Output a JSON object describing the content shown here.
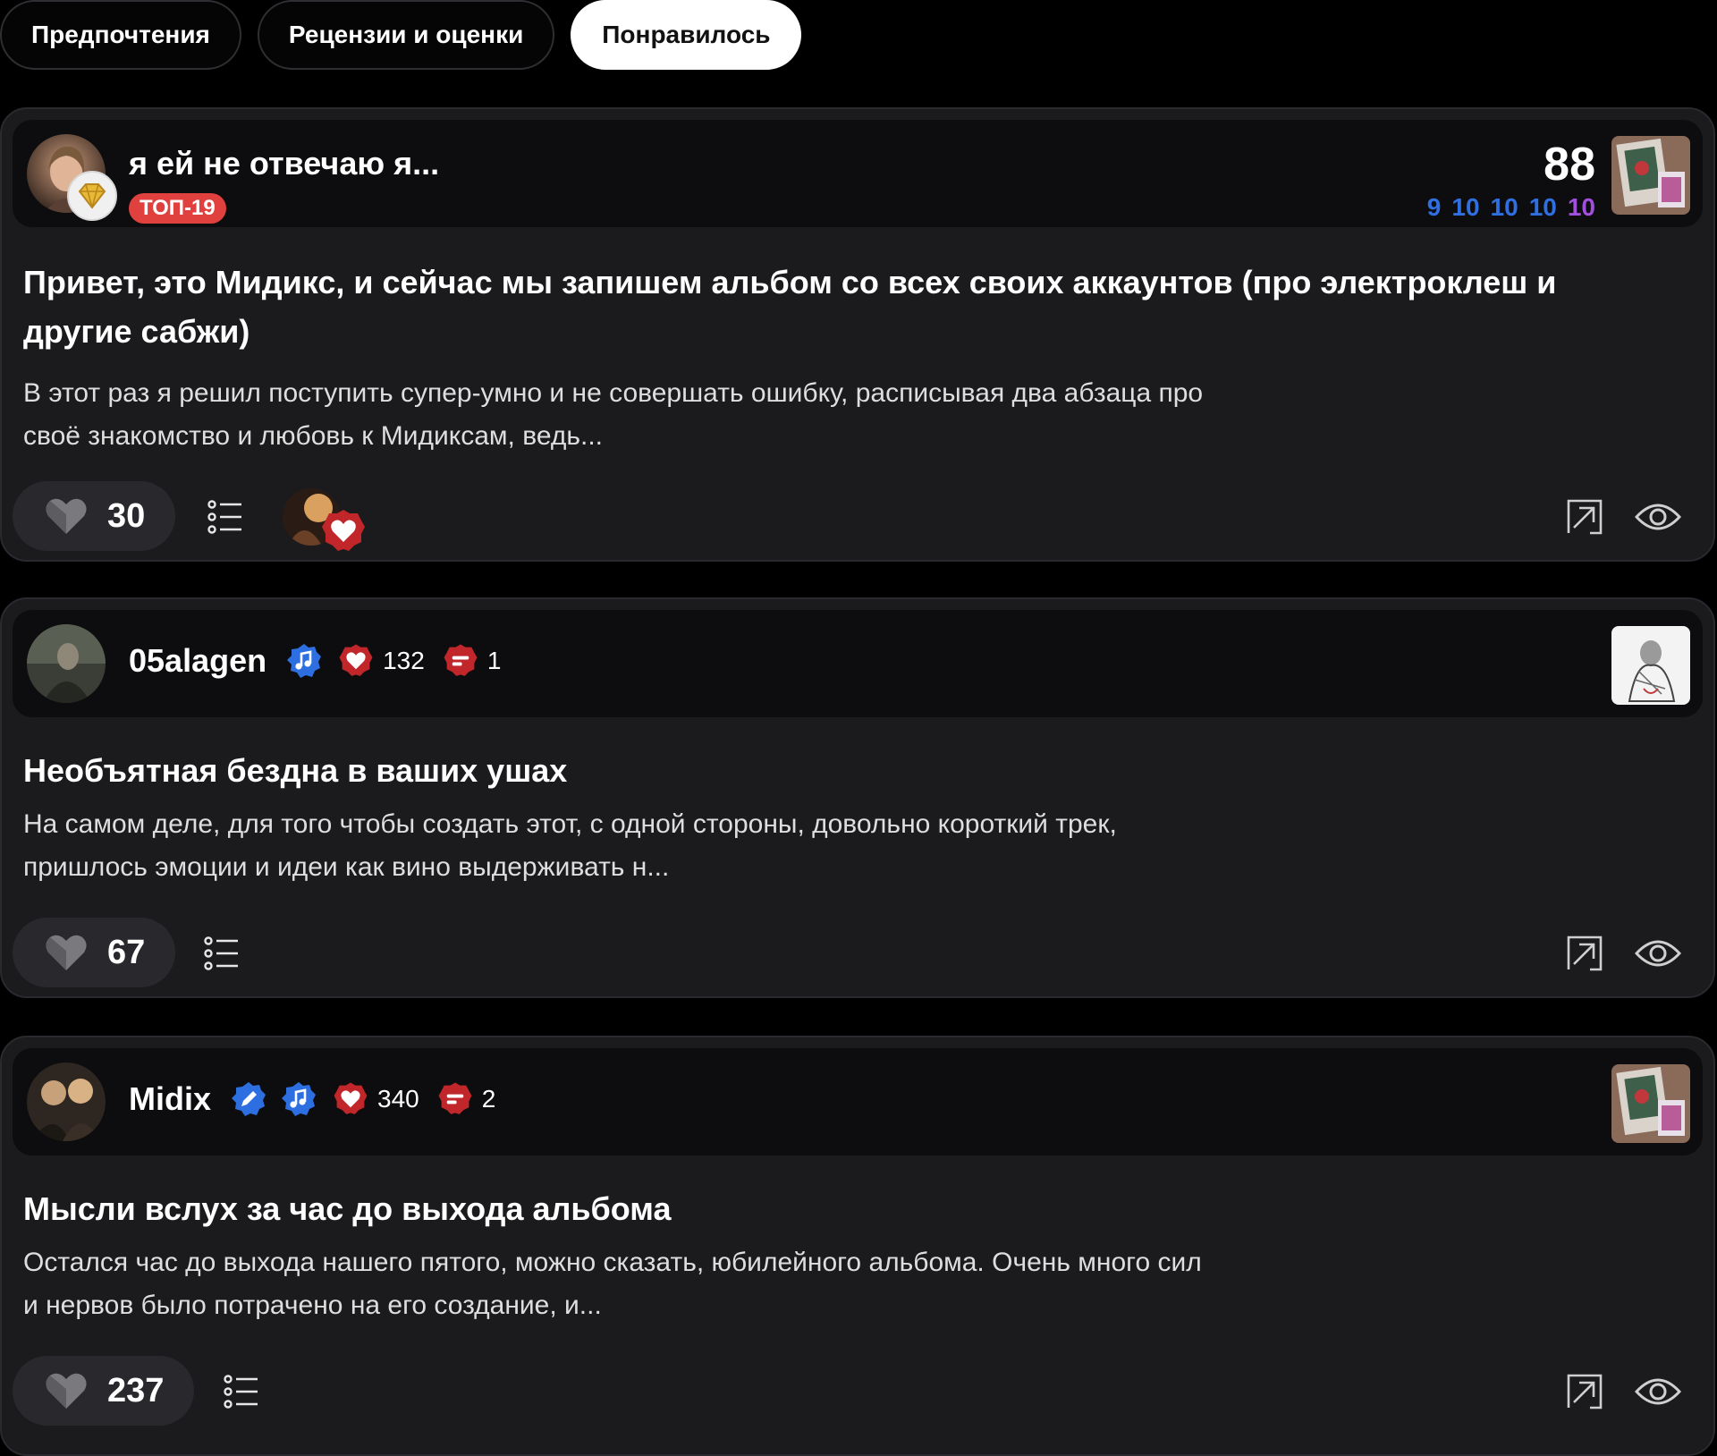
{
  "tabs": [
    {
      "label": "Предпочтения",
      "active": false
    },
    {
      "label": "Рецензии и оценки",
      "active": false
    },
    {
      "label": "Понравилось",
      "active": true
    }
  ],
  "cards": [
    {
      "author": "я ей не отвечаю я...",
      "badge": "ТОП-19",
      "score": "88",
      "subscores": [
        "9",
        "10",
        "10",
        "10",
        "10"
      ],
      "title": "Привет, это Мидикс, и сейчас мы запишем альбом со всех своих аккаунтов (про электроклеш и другие сабжи)",
      "excerpt": "В этот раз я решил поступить супер-умно и не совершать ошибку, расписывая два абзаца про своё знакомство и любовь к Мидиксам, ведь...",
      "likes": "30"
    },
    {
      "author": "05alagen",
      "likes_count": "132",
      "reviews_count": "1",
      "title": "Необъятная бездна в ваших ушах",
      "excerpt": "На самом деле, для того чтобы создать этот, с одной стороны, довольно короткий трек, пришлось эмоции и идеи как вино выдерживать н...",
      "likes": "67"
    },
    {
      "author": "Midix",
      "likes_count": "340",
      "reviews_count": "2",
      "title": "Мысли вслух за час до выхода альбома",
      "excerpt": "Остался час до выхода нашего пятого, можно сказать, юбилейного альбома. Очень много сил и нервов было потрачено на его создание, и...",
      "likes": "237"
    }
  ],
  "colors": {
    "score_blue": "#2f6fe0",
    "score_purple": "#a24fe0",
    "badge_red": "#e0413e",
    "verified_blue": "#2d6fe0",
    "heart_badge": "#c0262a"
  },
  "icons": [
    "heart-icon",
    "list-icon",
    "share-icon",
    "eye-icon",
    "verified-music-icon",
    "verified-pen-icon",
    "heart-badge-icon",
    "review-badge-icon"
  ]
}
